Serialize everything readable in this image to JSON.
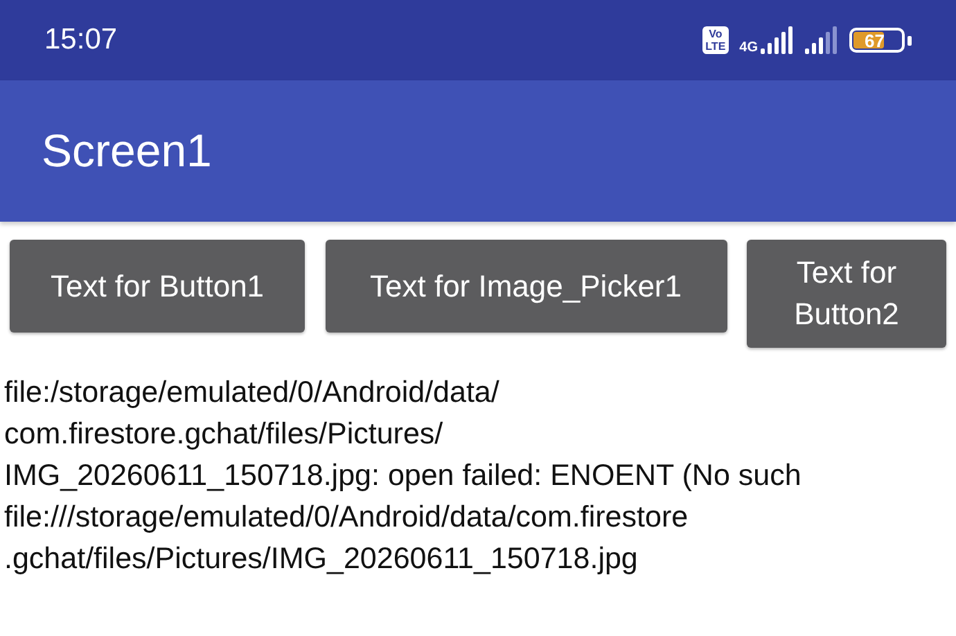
{
  "status_bar": {
    "time": "15:07",
    "volte": [
      "Vo",
      "LTE"
    ],
    "network": "4G",
    "battery": "67"
  },
  "app_bar": {
    "title": "Screen1"
  },
  "buttons": [
    {
      "label": "Text for Button1"
    },
    {
      "label": "Text for Image_Picker1"
    },
    {
      "label": "Text for Button2"
    }
  ],
  "messages": [
    {
      "lines": [
        "file:/storage/emulated/0/Android/data/",
        "com.firestore.gchat/files/Pictures/",
        "IMG_20260611_150718.jpg: open failed: ENOENT (No such"
      ]
    },
    {
      "lines": [
        "file:///storage/emulated/0/Android/data/com.firestore",
        ".gchat/files/Pictures/IMG_20260611_150718.jpg"
      ]
    }
  ]
}
